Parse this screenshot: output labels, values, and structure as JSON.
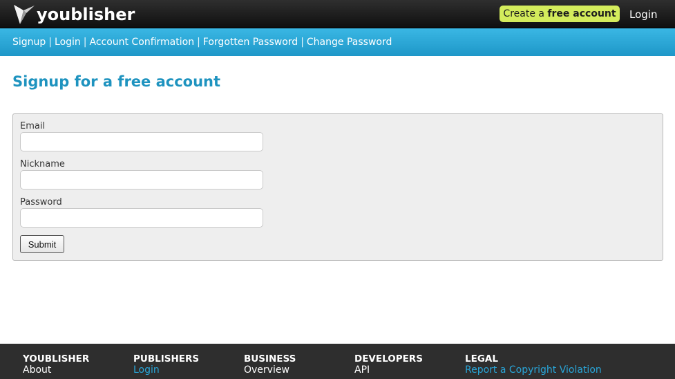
{
  "header": {
    "logo_text": "youblisher",
    "create_account": {
      "prefix": "Create a ",
      "bold": "free account"
    },
    "login_label": "Login"
  },
  "nav": {
    "items": [
      {
        "label": "Signup"
      },
      {
        "label": "Login"
      },
      {
        "label": "Account Confirmation"
      },
      {
        "label": "Forgotten Password"
      },
      {
        "label": "Change Password"
      }
    ],
    "separator": "|"
  },
  "main": {
    "title": "Signup for a free account",
    "form": {
      "email_label": "Email",
      "email_value": "",
      "nickname_label": "Nickname",
      "nickname_value": "",
      "password_label": "Password",
      "password_value": "",
      "submit_label": "Submit"
    }
  },
  "footer": {
    "columns": [
      {
        "heading": "YOUBLISHER",
        "links": [
          {
            "label": "About",
            "color": "white"
          }
        ]
      },
      {
        "heading": "PUBLISHERS",
        "links": [
          {
            "label": "Login",
            "color": "blue"
          }
        ]
      },
      {
        "heading": "BUSINESS",
        "links": [
          {
            "label": "Overview",
            "color": "white"
          }
        ]
      },
      {
        "heading": "DEVELOPERS",
        "links": [
          {
            "label": "API",
            "color": "white"
          }
        ]
      },
      {
        "heading": "LEGAL",
        "links": [
          {
            "label": "Report a Copyright Violation",
            "color": "blue"
          }
        ]
      }
    ]
  },
  "colors": {
    "accent_blue": "#1e93bf",
    "nav_blue": "#2aa8d8",
    "create_button": "#d4ec5c",
    "topbar": "#1a1a1a",
    "footer": "#2e2e2e"
  },
  "icons": {
    "logo": "origami-bird-logo-icon"
  }
}
